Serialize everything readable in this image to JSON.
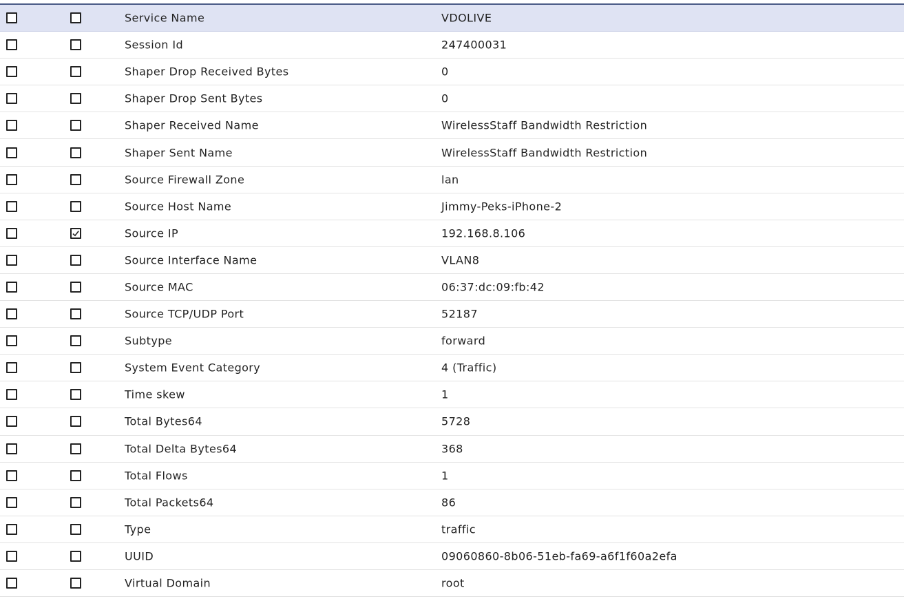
{
  "rows": [
    {
      "name": "Service Name",
      "value": "VDOLIVE",
      "checked_col1": false,
      "checked_col2": false,
      "highlighted": true
    },
    {
      "name": "Session Id",
      "value": "247400031",
      "checked_col1": false,
      "checked_col2": false
    },
    {
      "name": "Shaper Drop Received Bytes",
      "value": "0",
      "checked_col1": false,
      "checked_col2": false
    },
    {
      "name": "Shaper Drop Sent Bytes",
      "value": "0",
      "checked_col1": false,
      "checked_col2": false
    },
    {
      "name": "Shaper Received Name",
      "value": "WirelessStaff Bandwidth Restriction",
      "checked_col1": false,
      "checked_col2": false
    },
    {
      "name": "Shaper Sent Name",
      "value": "WirelessStaff Bandwidth Restriction",
      "checked_col1": false,
      "checked_col2": false
    },
    {
      "name": "Source Firewall Zone",
      "value": "lan",
      "checked_col1": false,
      "checked_col2": false
    },
    {
      "name": "Source Host Name",
      "value": "Jimmy-Peks-iPhone-2",
      "checked_col1": false,
      "checked_col2": false
    },
    {
      "name": "Source IP",
      "value": "192.168.8.106",
      "checked_col1": false,
      "checked_col2": true
    },
    {
      "name": "Source Interface Name",
      "value": "VLAN8",
      "checked_col1": false,
      "checked_col2": false
    },
    {
      "name": "Source MAC",
      "value": "06:37:dc:09:fb:42",
      "checked_col1": false,
      "checked_col2": false
    },
    {
      "name": "Source TCP/UDP Port",
      "value": "52187",
      "checked_col1": false,
      "checked_col2": false
    },
    {
      "name": "Subtype",
      "value": "forward",
      "checked_col1": false,
      "checked_col2": false
    },
    {
      "name": "System Event Category",
      "value": "4 (Traffic)",
      "checked_col1": false,
      "checked_col2": false
    },
    {
      "name": "Time skew",
      "value": "1",
      "checked_col1": false,
      "checked_col2": false
    },
    {
      "name": "Total Bytes64",
      "value": "5728",
      "checked_col1": false,
      "checked_col2": false
    },
    {
      "name": "Total Delta Bytes64",
      "value": "368",
      "checked_col1": false,
      "checked_col2": false
    },
    {
      "name": "Total Flows",
      "value": "1",
      "checked_col1": false,
      "checked_col2": false
    },
    {
      "name": "Total Packets64",
      "value": "86",
      "checked_col1": false,
      "checked_col2": false
    },
    {
      "name": "Type",
      "value": "traffic",
      "checked_col1": false,
      "checked_col2": false
    },
    {
      "name": "UUID",
      "value": "09060860-8b06-51eb-fa69-a6f1f60a2efa",
      "checked_col1": false,
      "checked_col2": false
    },
    {
      "name": "Virtual Domain",
      "value": "root",
      "checked_col1": false,
      "checked_col2": false
    }
  ],
  "colors": {
    "highlight_row": "#dfe3f3",
    "top_rule": "#4a5a86",
    "text": "#222222"
  },
  "icons": {
    "checkbox": "checkbox-icon",
    "checkmark": "checkmark-icon"
  }
}
